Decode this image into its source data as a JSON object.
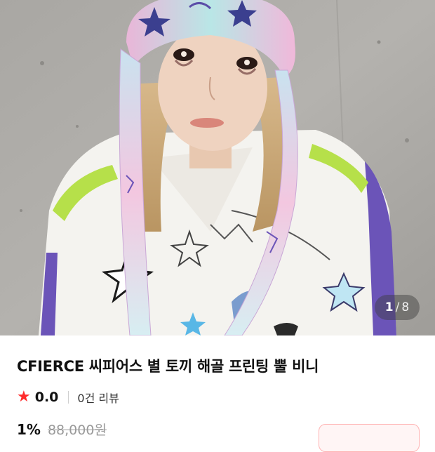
{
  "product": {
    "title": "CFIERCE 씨피어스 별 토끼 해골 프린팅 뿔 비니",
    "rating": "0.0",
    "review_count": "0건 리뷰",
    "discount_rate": "1%",
    "original_price": "88,000원"
  },
  "gallery": {
    "current": "1",
    "separator": "/",
    "total": "8"
  },
  "icons": {
    "rating": "star-icon"
  },
  "colors": {
    "accent": "#ff2b2b",
    "text": "#111111",
    "muted": "#9a9a9a",
    "coupon_border": "#ffb3b3"
  }
}
